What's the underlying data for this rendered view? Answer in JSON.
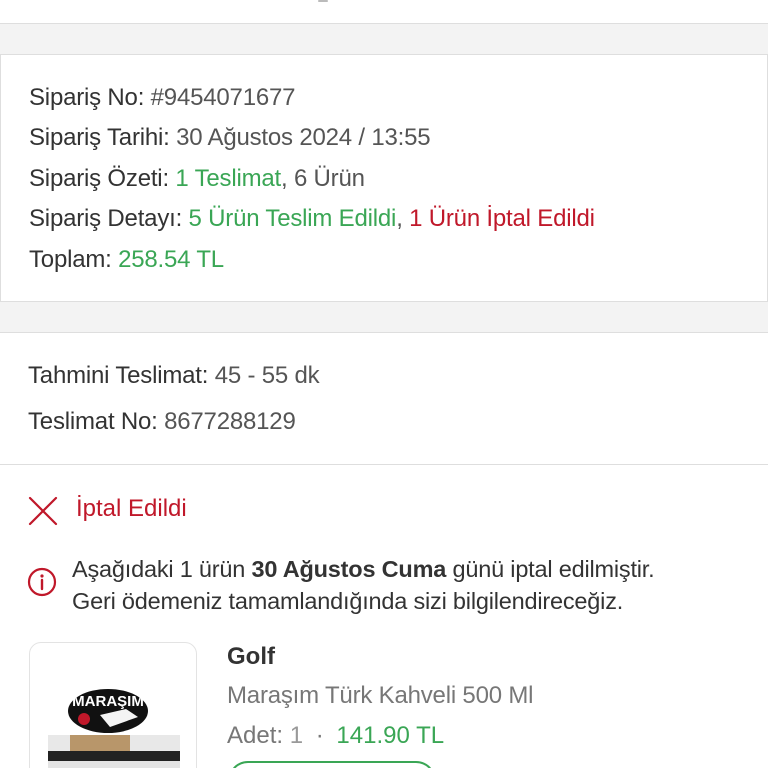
{
  "order": {
    "no_label": "Sipariş No:",
    "no_value": "#9454071677",
    "date_label": "Sipariş Tarihi:",
    "date_value": "30 Ağustos 2024 / 13:55",
    "summary_label": "Sipariş Özeti:",
    "summary_deliveries": "1 Teslimat",
    "summary_sep": ",",
    "summary_items": "6 Ürün",
    "detail_label": "Sipariş Detayı:",
    "detail_delivered": "5 Ürün Teslim Edildi",
    "detail_sep": ",",
    "detail_cancelled": "1 Ürün İptal Edildi",
    "total_label": "Toplam:",
    "total_value": "258.54 TL"
  },
  "delivery": {
    "eta_label": "Tahmini Teslimat:",
    "eta_value": "45 - 55 dk",
    "no_label": "Teslimat No:",
    "no_value": "8677288129",
    "status": "İptal Edildi",
    "notice_part1": "Aşağıdaki 1 ürün",
    "notice_date": "30 Ağustos Cuma",
    "notice_part2": "günü iptal edilmiştir.",
    "notice_line2": "Geri ödemeniz tamamlandığında sizi bilgilendireceğiz."
  },
  "product": {
    "brand": "Golf",
    "name": "Maraşım Türk Kahveli 500 Ml",
    "qty_label": "Adet:",
    "qty_value": "1",
    "separator": "·",
    "price": "141.90 TL",
    "package_logo": "MARAŞIM"
  },
  "colors": {
    "green": "#3aa655",
    "red": "#c0182a",
    "text": "#333333",
    "muted": "#777777"
  },
  "icons": {
    "status": "close-icon",
    "notice": "info-icon"
  }
}
